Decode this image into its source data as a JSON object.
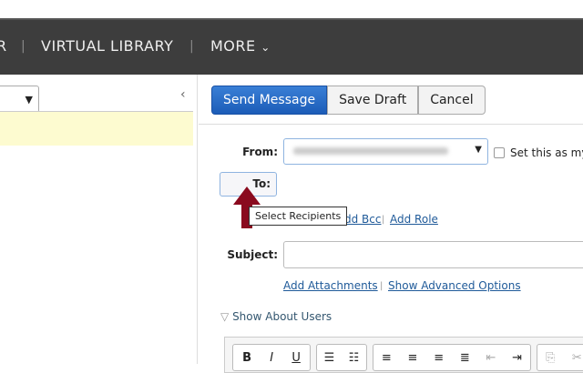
{
  "nav": {
    "items": [
      "R",
      "VIRTUAL LIBRARY",
      "MORE"
    ]
  },
  "toolbar": {
    "send": "Send Message",
    "save": "Save Draft",
    "cancel": "Cancel"
  },
  "form": {
    "from_label": "From:",
    "default_label": "Set this as my d",
    "to_label": "To:",
    "tooltip": "Select Recipients",
    "add_bcc": "Add Bcc",
    "add_role": "Add Role",
    "subject_label": "Subject:",
    "add_attachments": "Add Attachments",
    "advanced": "Show Advanced Options",
    "about_users": "Show About Users"
  },
  "editor": {
    "bold": "B",
    "italic": "I",
    "underline": "U"
  },
  "colors": {
    "nav": "#3d3d3d",
    "primary": "#1c5cb8",
    "arrow": "#8a0a1e",
    "highlight": "#fdfbd0"
  }
}
